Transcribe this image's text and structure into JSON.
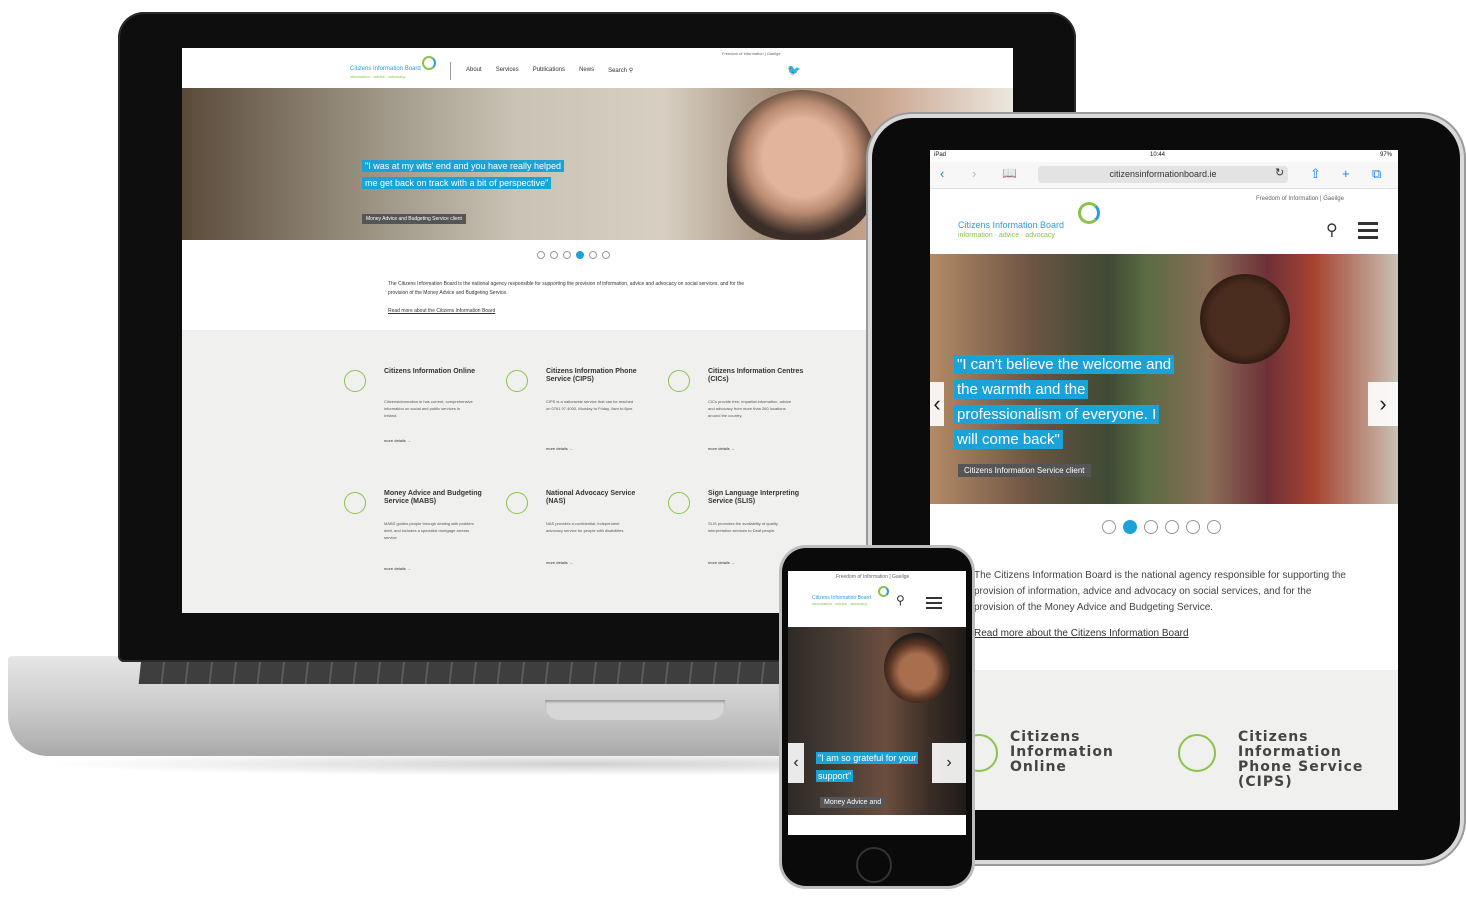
{
  "laptop": {
    "header": {
      "logo_text": "Citizens Information Board",
      "logo_sub": "information · advice · advocacy",
      "nav": [
        "About",
        "Services",
        "Publications",
        "News",
        "Search"
      ],
      "top_links": "Freedom of Information | Gaeilge"
    },
    "hero": {
      "quote": "\"I was at my wits' end and you have really helped me get back on track with a bit of perspective\"",
      "source": "Money Advice and Budgeting Service client",
      "dots": 6,
      "active_dot": 3
    },
    "intro": "The Citizens Information Board is the national agency responsible for supporting the provision of information, advice and advocacy on social services, and for the provision of the Money Advice and Budgeting Service.",
    "read_more": "Read more about the Citizens Information Board",
    "services": [
      {
        "title": "Citizens Information Online",
        "desc": "Citizensinformation.ie has current, comprehensive information on social and public services in Ireland.",
        "more": "more details →"
      },
      {
        "title": "Citizens Information Phone Service (CIPS)",
        "desc": "CIPS is a nationwide service that can be reached on 0761 07 4000, Monday to Friday, 9am to 8pm.",
        "more": "more details →"
      },
      {
        "title": "Citizens Information Centres (CICs)",
        "desc": "CICs provide free, impartial information, advice and advocacy from more than 260 locations around the country.",
        "more": "more details →"
      },
      {
        "title": "Money Advice and Budgeting Service (MABS)",
        "desc": "MABS guides people through dealing with problem debt, and includes a specialist mortgage arrears service.",
        "more": "more details →"
      },
      {
        "title": "National Advocacy Service (NAS)",
        "desc": "NAS provides a confidential, independent advocacy service for people with disabilities.",
        "more": "more details →"
      },
      {
        "title": "Sign Language Interpreting Service (SLIS)",
        "desc": "SLIS promotes the availability of quality interpretation services to Deaf people.",
        "more": "more details →"
      }
    ]
  },
  "tablet": {
    "status": {
      "carrier": "iPad",
      "time": "10:44",
      "battery": "97%"
    },
    "url": "citizensinformationboard.ie",
    "top_links": "Freedom of Information | Gaeilge",
    "logo_text": "Citizens Information Board",
    "logo_sub": "information · advice · advocacy",
    "hero": {
      "quote": "\"I can't believe the welcome and the warmth and the professionalism of everyone. I will come back\"",
      "source": "Citizens Information Service client",
      "dots": 6,
      "active_dot": 1
    },
    "intro": "The Citizens Information Board is the national agency responsible for supporting the provision of information, advice and advocacy on social services, and for the provision of the Money Advice and Budgeting Service.",
    "read_more": "Read more about the Citizens Information Board",
    "services": [
      {
        "title": "Citizens Information Online"
      },
      {
        "title": "Citizens Information Phone Service (CIPS)"
      }
    ]
  },
  "phone": {
    "top_links": "Freedom of Information | Gaeilge",
    "logo_text": "Citizens Information Board",
    "logo_sub": "information · advice · advocacy",
    "hero": {
      "quote": "\"I am so grateful for your support\"",
      "source": "Money Advice and"
    }
  },
  "colors": {
    "accent_blue": "#1ba3d8",
    "brand_green": "#8bc34a",
    "services_bg": "#f0f0ee"
  }
}
